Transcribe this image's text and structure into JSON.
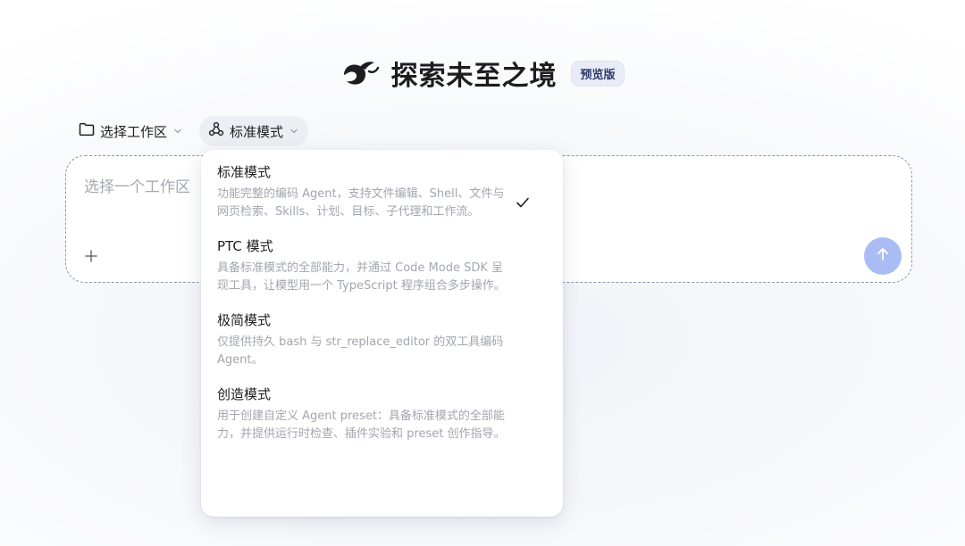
{
  "header": {
    "title": "探索未至之境",
    "badge": "预览版",
    "logo_icon": "whale-logo-icon"
  },
  "toolbar": {
    "workspace_label": "选择工作区",
    "mode_label": "标准模式"
  },
  "input": {
    "placeholder": "选择一个工作区"
  },
  "colors": {
    "send_button": "#a9bdf4",
    "badge_bg": "#e9ecf6",
    "badge_text": "#2f3a6b"
  },
  "mode_menu": {
    "selected": "标准模式",
    "items": [
      {
        "title": "标准模式",
        "description": "功能完整的编码 Agent，支持文件编辑、Shell、文件与网页检索、Skills、计划、目标、子代理和工作流。",
        "selected": true
      },
      {
        "title": "PTC 模式",
        "description": "具备标准模式的全部能力，并通过 Code Mode SDK 呈现工具，让模型用一个 TypeScript 程序组合多步操作。",
        "selected": false
      },
      {
        "title": "极简模式",
        "description": "仅提供持久 bash 与 str_replace_editor 的双工具编码 Agent。",
        "selected": false
      },
      {
        "title": "创造模式",
        "description": "用于创建自定义 Agent preset：具备标准模式的全部能力，并提供运行时检查、插件实验和 preset 创作指导。",
        "selected": false
      }
    ]
  }
}
